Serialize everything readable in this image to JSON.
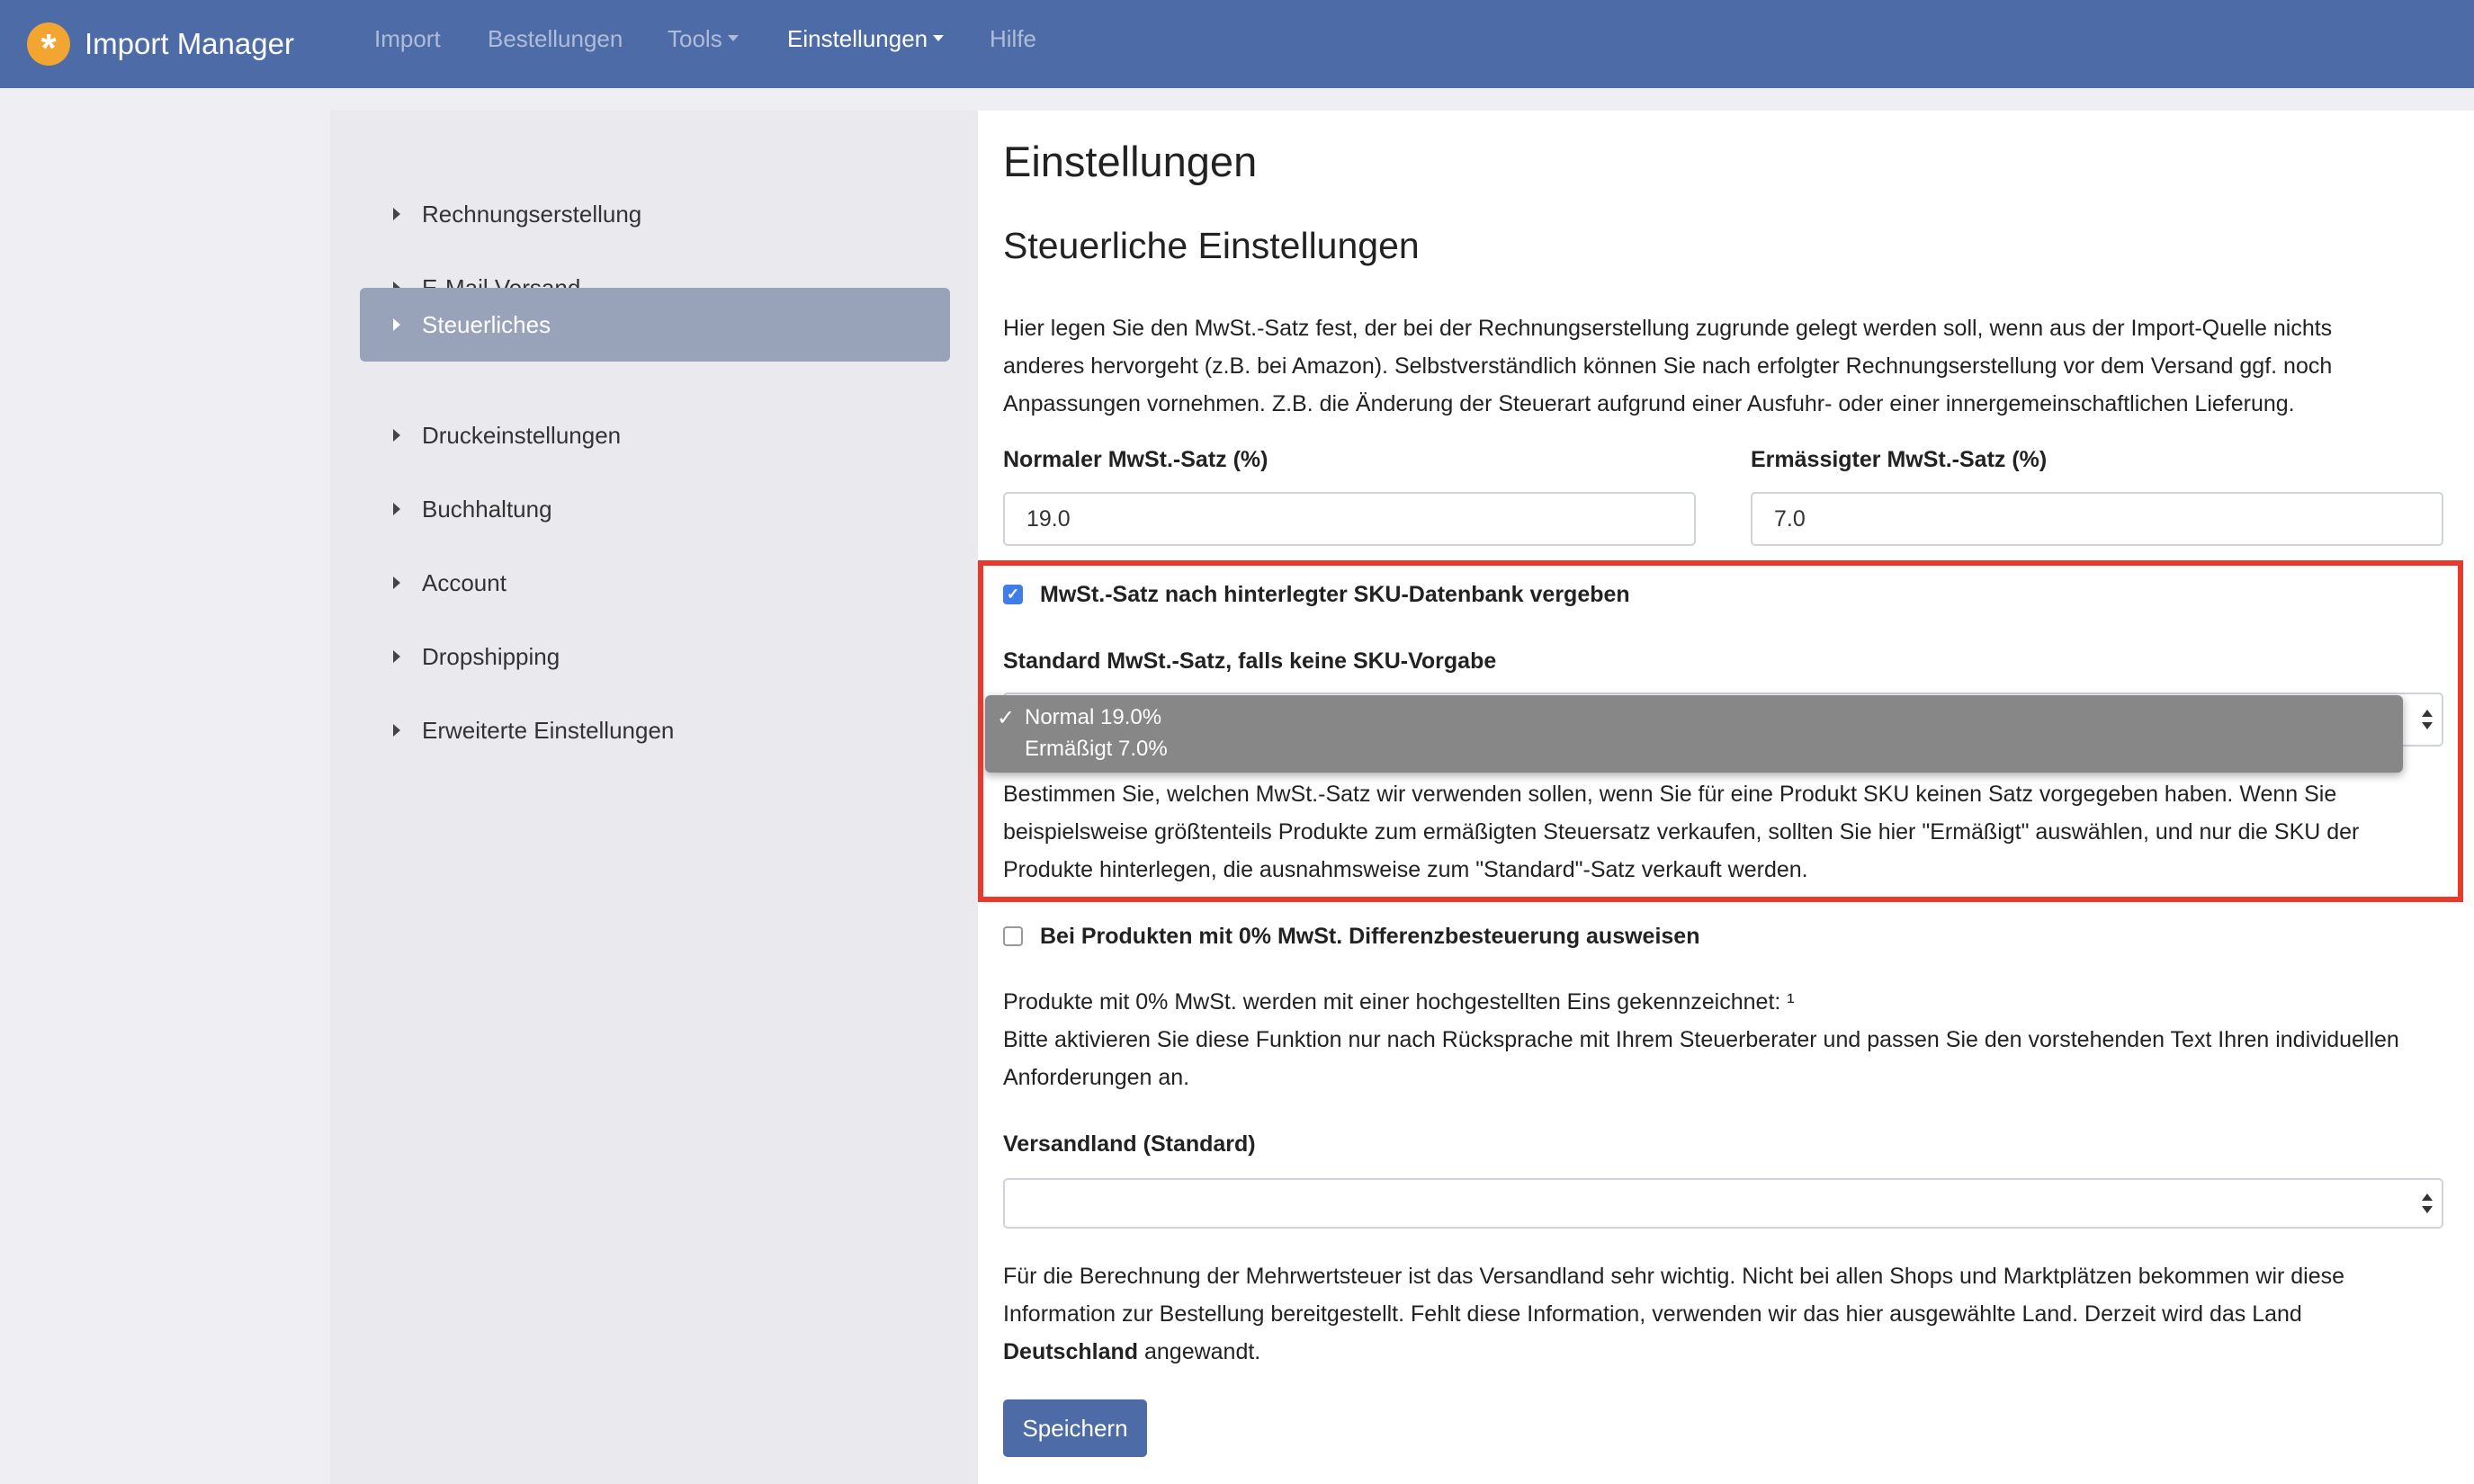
{
  "app": {
    "name": "Import Manager",
    "logo_glyph": "*",
    "logo_color": "#f2a531",
    "nav_color": "#4d6ba6"
  },
  "nav": {
    "import": "Import",
    "orders": "Bestellungen",
    "tools": "Tools",
    "settings": "Einstellungen",
    "help": "Hilfe"
  },
  "sidebar": {
    "items": [
      {
        "label": "Rechnungserstellung"
      },
      {
        "label": "E-Mail Versand"
      },
      {
        "label": "Steuerliches",
        "active": true
      },
      {
        "label": "Druckeinstellungen"
      },
      {
        "label": "Buchhaltung"
      },
      {
        "label": "Account"
      },
      {
        "label": "Dropshipping"
      },
      {
        "label": "Erweiterte Einstellungen"
      }
    ]
  },
  "main": {
    "title": "Einstellungen",
    "section_title": "Steuerliche Einstellungen",
    "intro": [
      "Hier legen Sie den MwSt.-Satz fest, der bei der Rechnungserstellung zugrunde gelegt werden soll, wenn aus der Import-Quelle nichts",
      "anderes hervorgeht (z.B. bei Amazon). Selbstverständlich können Sie nach erfolgter Rechnungserstellung vor dem Versand ggf. noch",
      "Anpassungen vornehmen. Z.B. die Änderung der Steuerart aufgrund einer Ausfuhr- oder einer innergemeinschaftlichen Lieferung."
    ],
    "normal_rate": {
      "label": "Normaler MwSt.-Satz (%)",
      "value": "19.0"
    },
    "reduced_rate": {
      "label": "Ermässigter MwSt.-Satz (%)",
      "value": "7.0"
    },
    "sku_checkbox": {
      "label": "MwSt.-Satz nach hinterlegter SKU-Datenbank vergeben",
      "checked": true
    },
    "default_rate": {
      "label": "Standard MwSt.-Satz, falls keine SKU-Vorgabe",
      "options": [
        "Normal 19.0%",
        "Ermäßigt 7.0%"
      ],
      "selected": "Normal 19.0%",
      "check_glyph": "✓"
    },
    "default_rate_help": [
      "Bestimmen Sie, welchen MwSt.-Satz wir verwenden sollen, wenn Sie für eine Produkt SKU keinen Satz vorgegeben haben. Wenn Sie",
      "beispielsweise größtenteils Produkte zum ermäßigten Steuersatz verkaufen, sollten Sie hier \"Ermäßigt\" auswählen, und nur die SKU der",
      "Produkte hinterlegen, die ausnahmsweise zum \"Standard\"-Satz verkauft werden."
    ],
    "margin_checkbox": {
      "label": "Bei Produkten mit 0% MwSt. Differenzbesteuerung ausweisen",
      "checked": false
    },
    "margin_help": [
      "Produkte mit 0% MwSt. werden mit einer hochgestellten Eins gekennzeichnet: ¹",
      "Bitte aktivieren Sie diese Funktion nur nach Rücksprache mit Ihrem Steuerberater und passen Sie den vorstehenden Text Ihren individuellen",
      "Anforderungen an."
    ],
    "shipping_country": {
      "label": "Versandland (Standard)",
      "value": ""
    },
    "shipping_help": {
      "line1": "Für die Berechnung der Mehrwertsteuer ist das Versandland sehr wichtig. Nicht bei allen Shops und Marktplätzen bekommen wir diese",
      "line2": "Information zur Bestellung bereitgestellt. Fehlt diese Information, verwenden wir das hier ausgewählte Land. Derzeit wird das Land",
      "country": "Deutschland",
      "suffix": " angewandt."
    },
    "save_label": "Speichern"
  },
  "annotation": {
    "highlight_color": "#e8392a"
  }
}
